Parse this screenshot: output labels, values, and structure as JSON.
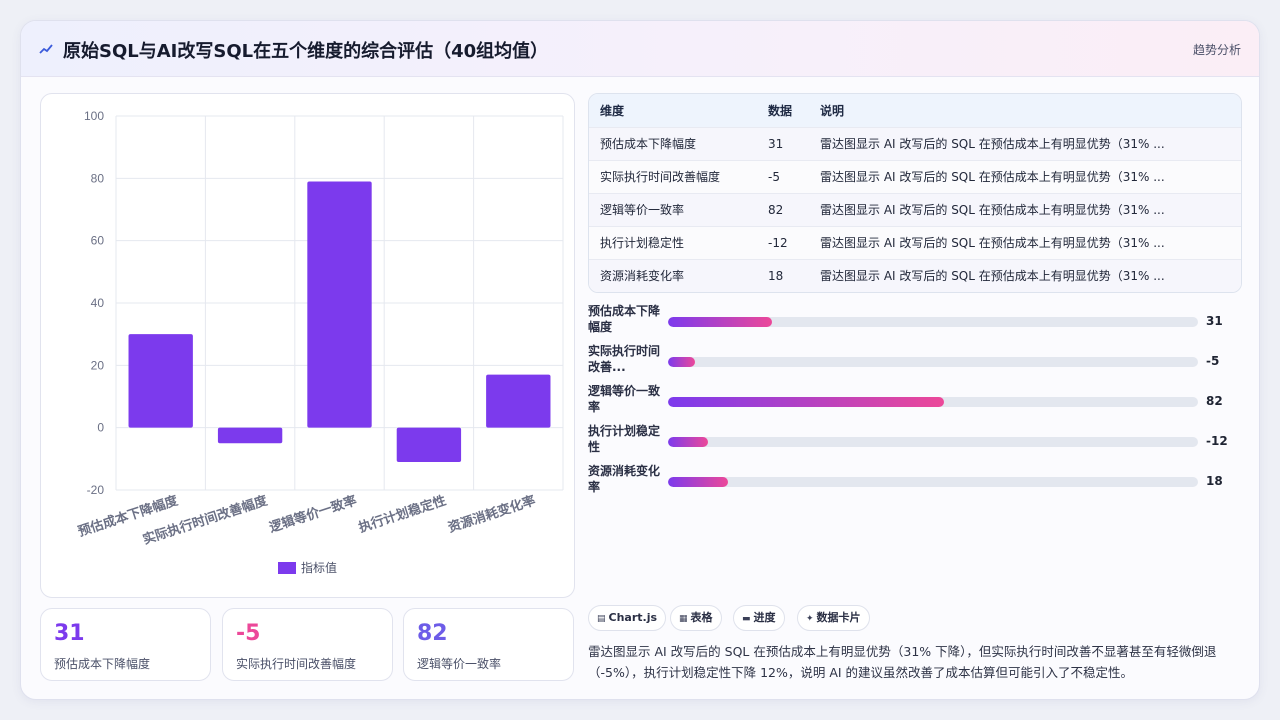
{
  "header": {
    "icon": "trend-line-icon",
    "title": "原始SQL与AI改写SQL在五个维度的综合评估（40组均值）",
    "trend_link": "趋势分析"
  },
  "chart_data": {
    "type": "bar",
    "categories": [
      "预估成本下降幅度",
      "实际执行时间改善幅度",
      "逻辑等价一致率",
      "执行计划稳定性",
      "资源消耗变化率"
    ],
    "series": [
      {
        "name": "指标值",
        "values": [
          30,
          -5,
          79,
          -11,
          17
        ]
      }
    ],
    "ylim": [
      -20,
      100
    ],
    "yticks": [
      100,
      80,
      60,
      40,
      20,
      0,
      -20
    ],
    "grid": true,
    "legend": "bottom",
    "bar_color": "#7c3aed"
  },
  "stats": [
    {
      "value": "31",
      "label": "预估成本下降幅度",
      "color": "#7c3aed"
    },
    {
      "value": "-5",
      "label": "实际执行时间改善幅度",
      "color": "#ec4899"
    },
    {
      "value": "82",
      "label": "逻辑等价一致率",
      "color": "#6d5ce8"
    }
  ],
  "table": {
    "headers": [
      "维度",
      "数据",
      "说明"
    ],
    "rows": [
      [
        "预估成本下降幅度",
        "31",
        "雷达图显示 AI 改写后的 SQL 在预估成本上有明显优势（31% ..."
      ],
      [
        "实际执行时间改善幅度",
        "-5",
        "雷达图显示 AI 改写后的 SQL 在预估成本上有明显优势（31% ..."
      ],
      [
        "逻辑等价一致率",
        "82",
        "雷达图显示 AI 改写后的 SQL 在预估成本上有明显优势（31% ..."
      ],
      [
        "执行计划稳定性",
        "-12",
        "雷达图显示 AI 改写后的 SQL 在预估成本上有明显优势（31% ..."
      ],
      [
        "资源消耗变化率",
        "18",
        "雷达图显示 AI 改写后的 SQL 在预估成本上有明显优势（31% ..."
      ]
    ]
  },
  "progress": [
    {
      "label": "预估成本下降幅度",
      "value": "31",
      "fill": 0.196
    },
    {
      "label": "实际执行时间改善...",
      "value": "-5",
      "fill": 0.05
    },
    {
      "label": "逻辑等价一致率",
      "value": "82",
      "fill": 0.52
    },
    {
      "label": "执行计划稳定性",
      "value": "-12",
      "fill": 0.075
    },
    {
      "label": "资源消耗变化率",
      "value": "18",
      "fill": 0.114
    }
  ],
  "chips": [
    {
      "icon": "chart-icon",
      "glyph": "▤",
      "label": "Chart.js"
    },
    {
      "icon": "table-icon",
      "glyph": "▦",
      "label": "表格"
    },
    {
      "icon": "progress-icon",
      "glyph": "▬",
      "label": "进度"
    },
    {
      "icon": "sparkle-icon",
      "glyph": "✦",
      "label": "数据卡片"
    }
  ],
  "description": "雷达图显示 AI 改写后的 SQL 在预估成本上有明显优势（31% 下降），但实际执行时间改善不显著甚至有轻微倒退（-5%），执行计划稳定性下降 12%，说明 AI 的建议虽然改善了成本估算但可能引入了不稳定性。"
}
